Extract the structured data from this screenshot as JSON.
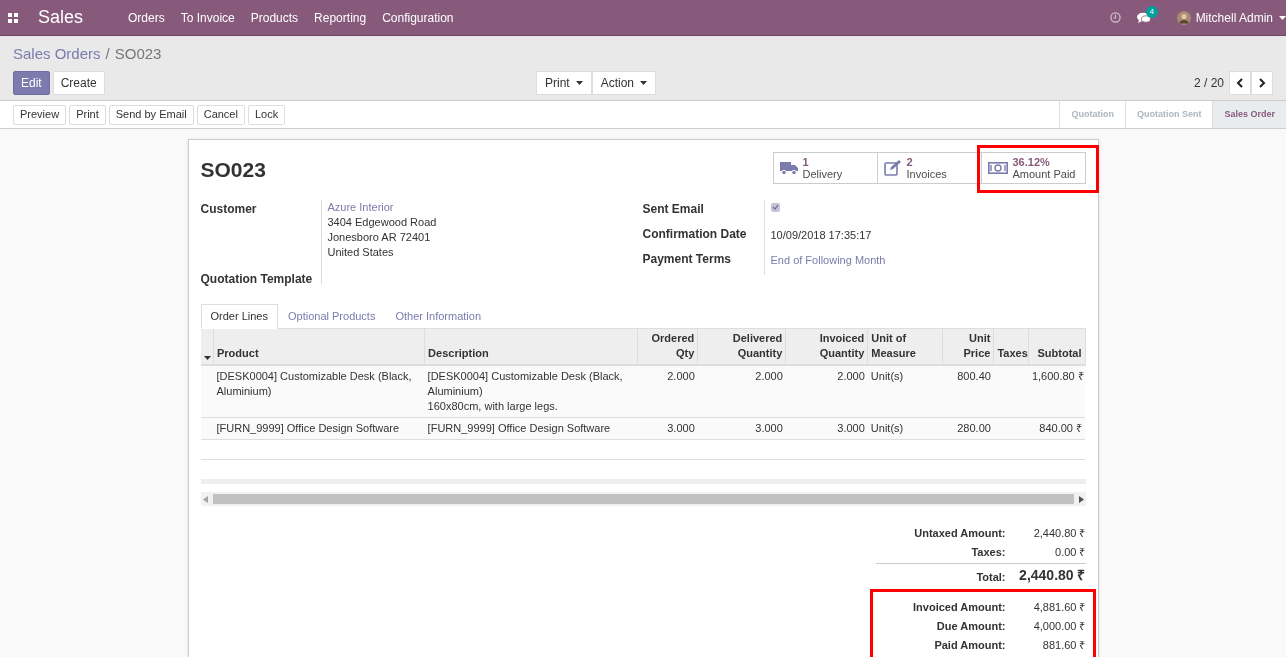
{
  "navbar": {
    "app": "Sales",
    "menu": [
      "Orders",
      "To Invoice",
      "Products",
      "Reporting",
      "Configuration"
    ],
    "message_count": "4",
    "user": "Mitchell Admin"
  },
  "breadcrumb": {
    "parent": "Sales Orders",
    "separator": "/",
    "current": "SO023"
  },
  "primary_buttons": [
    {
      "label": "Edit",
      "kind": "primary"
    },
    {
      "label": "Create",
      "kind": "secondary"
    }
  ],
  "dropdowns": [
    "Print",
    "Action"
  ],
  "pager": "2 / 20",
  "header_buttons": [
    "Preview",
    "Print",
    "Send by Email",
    "Cancel",
    "Lock"
  ],
  "stages": [
    {
      "label": "Quotation",
      "selected": false
    },
    {
      "label": "Quotation Sent",
      "selected": false
    },
    {
      "label": "Sales Order",
      "selected": true
    }
  ],
  "title": "SO023",
  "stat_buttons": [
    {
      "kind": "truck",
      "value": "1",
      "label": "Delivery",
      "highlighted": false
    },
    {
      "kind": "edit",
      "value": "2",
      "label": "Invoices",
      "highlighted": false
    },
    {
      "kind": "money",
      "value": "36.12%",
      "label": "Amount Paid",
      "highlighted": true
    }
  ],
  "fields_left": [
    {
      "label": "Customer",
      "link": "Azure Interior",
      "lines": [
        "3404 Edgewood Road",
        "Jonesboro AR 72401",
        "United States"
      ]
    },
    {
      "label": "Quotation Template"
    }
  ],
  "fields_right": [
    {
      "label": "Sent Email",
      "kind": "checkbox",
      "checked": true
    },
    {
      "label": "Confirmation Date",
      "kind": "text",
      "value": "10/09/2018 17:35:17"
    },
    {
      "label": "Payment Terms",
      "kind": "link",
      "value": "End of Following Month"
    }
  ],
  "tabs": [
    {
      "label": "Order Lines",
      "selected": true
    },
    {
      "label": "Optional Products",
      "selected": false
    },
    {
      "label": "Other Information",
      "selected": false
    }
  ],
  "table": {
    "columns": [
      [
        "Product"
      ],
      [
        "Description"
      ],
      [
        "Ordered",
        "Qty"
      ],
      [
        "Delivered",
        "Quantity"
      ],
      [
        "Invoiced",
        "Quantity"
      ],
      [
        "Unit of",
        "Measure"
      ],
      [
        "Unit",
        "Price"
      ],
      [
        "Taxes"
      ],
      [
        "Subtotal"
      ]
    ],
    "rows": [
      {
        "product": "[DESK0004] Customizable Desk (Black, Aluminium)",
        "description": [
          "[DESK0004] Customizable Desk (Black, Aluminium)",
          "160x80cm, with large legs."
        ],
        "ordered": "2.000",
        "delivered": "2.000",
        "invoiced": "2.000",
        "uom": "Unit(s)",
        "price": "800.40",
        "subtotal": "1,600.80 ₹"
      },
      {
        "product": "[FURN_9999] Office Design Software",
        "description": [
          "[FURN_9999] Office Design Software"
        ],
        "ordered": "3.000",
        "delivered": "3.000",
        "invoiced": "3.000",
        "uom": "Unit(s)",
        "price": "280.00",
        "subtotal": "840.00 ₹"
      }
    ]
  },
  "totals": [
    {
      "label": "Untaxed Amount:",
      "value": "2,440.80 ₹",
      "kind": "normal"
    },
    {
      "label": "Taxes:",
      "value": "0.00 ₹",
      "kind": "normal"
    },
    {
      "label": "Total:",
      "value": "2,440.80 ₹",
      "kind": "total"
    }
  ],
  "payment_totals": {
    "highlighted": true,
    "rows": [
      {
        "label": "Invoiced Amount:",
        "value": "4,881.60 ₹"
      },
      {
        "label": "Due Amount:",
        "value": "4,000.00 ₹"
      },
      {
        "label": "Paid Amount:",
        "value": "881.60 ₹"
      }
    ]
  }
}
